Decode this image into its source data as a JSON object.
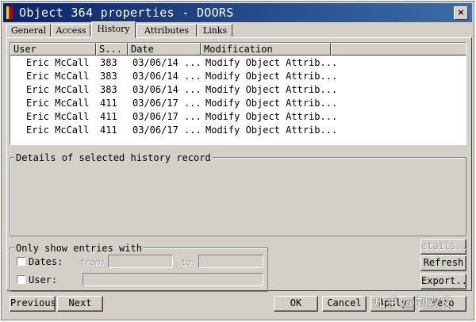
{
  "window": {
    "title": "Object 364 properties - DOORS",
    "close_label": "×"
  },
  "tabs": [
    {
      "label": "General"
    },
    {
      "label": "Access"
    },
    {
      "label": "History",
      "active": true
    },
    {
      "label": "Attributes"
    },
    {
      "label": "Links"
    }
  ],
  "history_table": {
    "columns": [
      "User",
      "S...",
      "Date",
      "Modification"
    ],
    "rows": [
      {
        "user": "Eric McCall",
        "s": "383",
        "date": "03/06/14 ...",
        "modification": "Modify Object Attrib..."
      },
      {
        "user": "Eric McCall",
        "s": "383",
        "date": "03/06/14 ...",
        "modification": "Modify Object Attrib..."
      },
      {
        "user": "Eric McCall",
        "s": "383",
        "date": "03/06/14 ...",
        "modification": "Modify Object Attrib..."
      },
      {
        "user": "Eric McCall",
        "s": "411",
        "date": "03/06/17 ...",
        "modification": "Modify Object Attrib..."
      },
      {
        "user": "Eric McCall",
        "s": "411",
        "date": "03/06/17 ...",
        "modification": "Modify Object Attrib..."
      },
      {
        "user": "Eric McCall",
        "s": "411",
        "date": "03/06/17 ...",
        "modification": "Modify Object Attrib..."
      }
    ]
  },
  "details": {
    "label": "Details of selected history record"
  },
  "filter": {
    "label": "Only show entries with",
    "dates_label": "Dates:",
    "from_label": "from:",
    "to_label": "to:",
    "user_label": "User:",
    "dates_checked": false,
    "user_checked": false
  },
  "side_buttons": {
    "details": "etails..",
    "refresh": "Refresh",
    "export": "Export..."
  },
  "footer_buttons": {
    "previous": "Previous",
    "next": "Next",
    "ok": "OK",
    "cancel": "Cancel",
    "apply": "Apply",
    "help": "Help"
  },
  "watermark": "知乎 @刘双文",
  "colors": {
    "titlebar_start": "#0a246a",
    "titlebar_end": "#3b6ea5",
    "face": "#d4d0c8"
  }
}
